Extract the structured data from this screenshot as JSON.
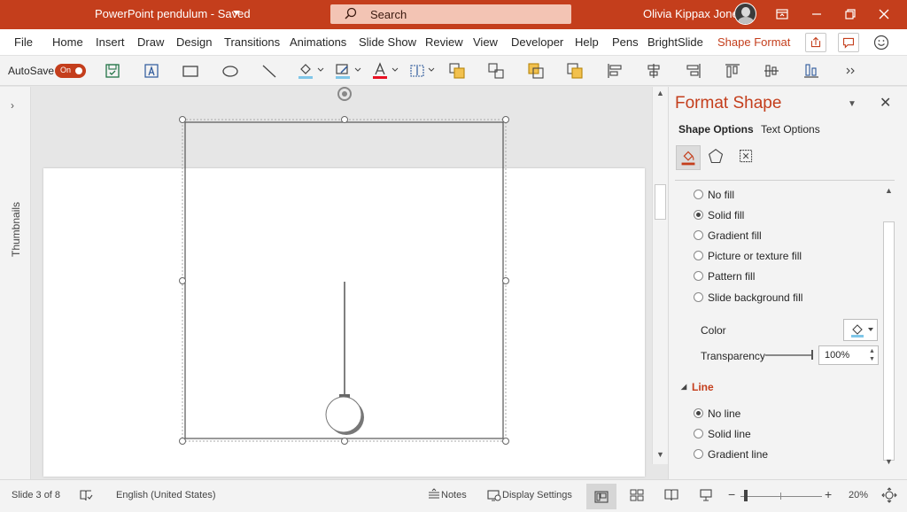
{
  "titlebar": {
    "doc_title": "PowerPoint pendulum  -  Saved",
    "search_placeholder": "Search",
    "user_name": "Olivia Kippax Jones",
    "accent": "#c43e1c"
  },
  "ribbon_tabs": [
    {
      "label": "File"
    },
    {
      "label": "Home"
    },
    {
      "label": "Insert"
    },
    {
      "label": "Draw"
    },
    {
      "label": "Design"
    },
    {
      "label": "Transitions"
    },
    {
      "label": "Animations"
    },
    {
      "label": "Slide Show"
    },
    {
      "label": "Review"
    },
    {
      "label": "View"
    },
    {
      "label": "Developer"
    },
    {
      "label": "Help"
    },
    {
      "label": "Pens"
    },
    {
      "label": "BrightSlide"
    },
    {
      "label": "Shape Format",
      "active": true
    }
  ],
  "toolbar": {
    "autosave_label": "AutoSave",
    "autosave_state": "On",
    "icons": [
      "save-icon",
      "text-box-icon",
      "rectangle-icon",
      "oval-icon",
      "line-icon",
      "shape-fill-icon",
      "shape-outline-icon",
      "font-color-icon",
      "align-text-icon",
      "bring-forward-icon",
      "group-icon",
      "send-backward-icon",
      "arrange-icon",
      "align-left-icon",
      "align-center-icon",
      "align-right-icon",
      "align-top-icon",
      "align-middle-icon",
      "align-bottom-icon",
      "more-icon"
    ]
  },
  "thumbnails_label": "Thumbnails",
  "format_pane": {
    "title": "Format Shape",
    "subtabs": [
      "Shape Options",
      "Text Options"
    ],
    "fill_options": [
      {
        "label": "No fill",
        "checked": false
      },
      {
        "label": "Solid fill",
        "checked": true
      },
      {
        "label": "Gradient fill",
        "checked": false
      },
      {
        "label": "Picture or texture fill",
        "checked": false
      },
      {
        "label": "Pattern fill",
        "checked": false
      },
      {
        "label": "Slide background fill",
        "checked": false
      }
    ],
    "color_label": "Color",
    "transparency_label": "Transparency",
    "transparency_value": "100%",
    "transparency_fraction": 1.0,
    "line_section": "Line",
    "line_options": [
      {
        "label": "No line",
        "checked": true
      },
      {
        "label": "Solid line",
        "checked": false
      },
      {
        "label": "Gradient line",
        "checked": false
      }
    ]
  },
  "statusbar": {
    "slide_info": "Slide 3 of 8",
    "language": "English (United States)",
    "notes_label": "Notes",
    "display_settings_label": "Display Settings",
    "zoom_minus": "−",
    "zoom_plus": "+",
    "zoom_level": "20%"
  }
}
